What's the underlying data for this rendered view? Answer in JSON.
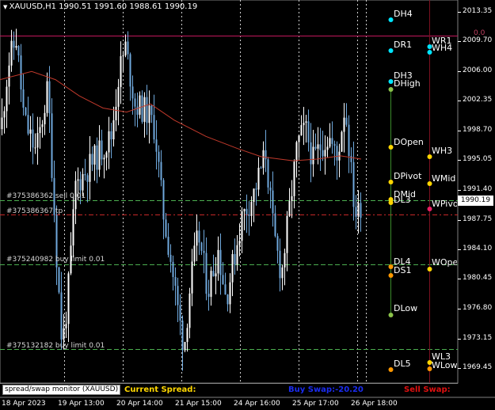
{
  "header": {
    "symbol": "XAUUSD,H1",
    "ohlc": "1990.51 1991.60 1988.61 1990.19"
  },
  "price_axis": {
    "ticks": [
      "2013.35",
      "2009.70",
      "2006.00",
      "2002.35",
      "1998.70",
      "1995.05",
      "1991.40",
      "1987.75",
      "1984.10",
      "1980.45",
      "1976.80",
      "1973.15",
      "1969.45"
    ],
    "current_price": "1990.19"
  },
  "time_axis": {
    "ticks": [
      "18 Apr 2023",
      "19 Apr 13:00",
      "20 Apr 14:00",
      "21 Apr 15:00",
      "24 Apr 16:00",
      "25 Apr 17:00",
      "26 Apr 18:00"
    ]
  },
  "pivots": {
    "daily": [
      "DH4",
      "DR1",
      "DH3",
      "DHigh",
      "DOpen",
      "DPivot",
      "DMid",
      "DL3",
      "DL4",
      "DS1",
      "DLow",
      "DL5"
    ],
    "weekly": [
      "WR1",
      "WH4",
      "WH3",
      "WMid",
      "WPivot",
      "WOpen",
      "WL3",
      "WLow"
    ],
    "zero_marker": "0.0"
  },
  "colors": {
    "background": "#000000",
    "bull_candle": "#ffffff",
    "bear_candle": "#6fa8dc",
    "moving_average": "#c0392b",
    "pending_order_line": "#4caf50",
    "tp_line": "#c62828",
    "resistance_line": "#c2185b",
    "daily_marker_cyan": "#00e5ff",
    "daily_marker_yellow": "#ffd600",
    "daily_marker_orange": "#ff9800",
    "daily_marker_green": "#8bc34a",
    "weekly_marker_magenta": "#e91e63"
  },
  "orders": {
    "sell_label": "#375386362 sell 0.01",
    "buy_limit_label": "#375240982 buy limit 0.01",
    "buy_limit_label_2": "#375132182 buy limit 0.01",
    "tp_label": "#375386367 tp"
  },
  "monitor": {
    "title": "spread/swap monitor (XAUUSD)",
    "spread": "Current Spread:",
    "buy_swap": "Buy Swap:-20.20",
    "sell_swap": "Sell Swap:"
  },
  "chart_data": {
    "type": "candlestick",
    "x_axis": [
      "18 Apr 2023",
      "19 Apr 13:00",
      "20 Apr 14:00",
      "21 Apr 15:00",
      "24 Apr 16:00",
      "25 Apr 17:00",
      "26 Apr 18:00"
    ],
    "ylim": [
      1968.0,
      2015.0
    ],
    "indicators": [
      "moving average (red)",
      "daily pivot levels",
      "weekly pivot levels"
    ],
    "last_close": 1990.19
  }
}
